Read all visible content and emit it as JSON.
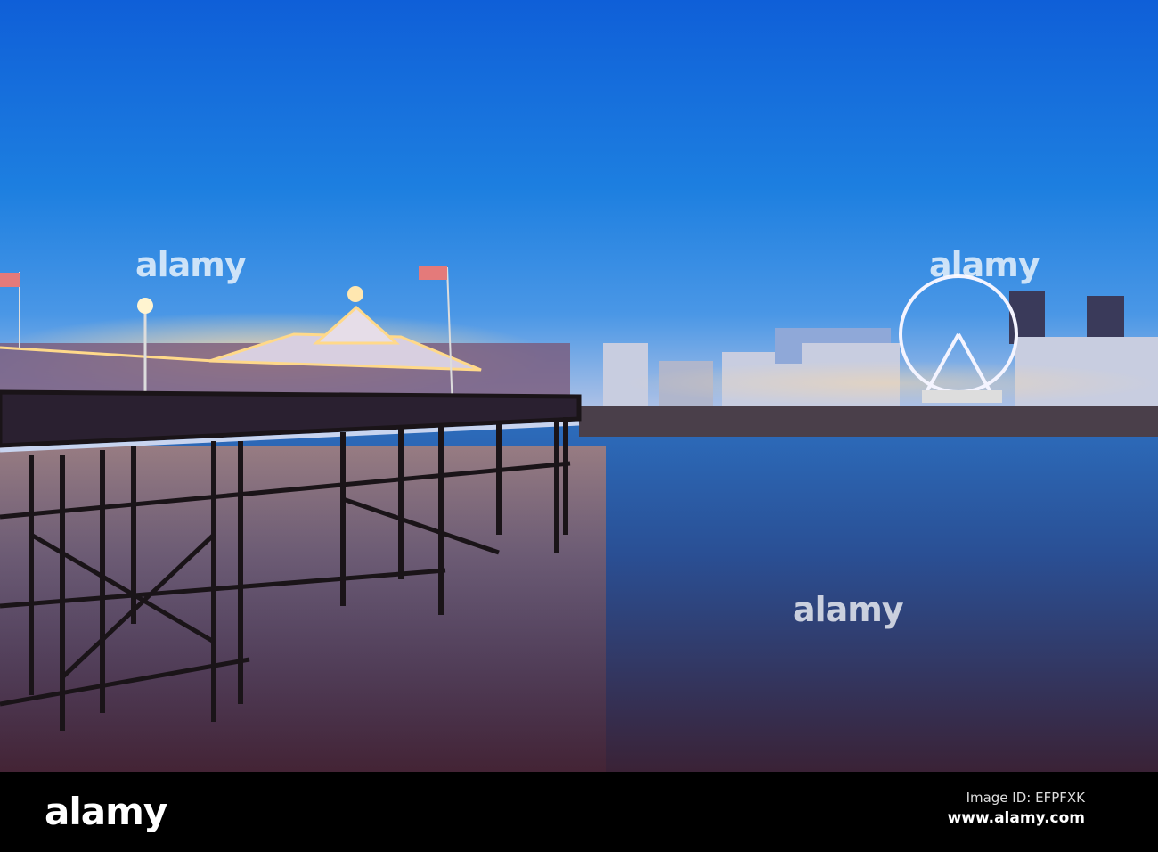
{
  "watermark": {
    "text": "alamy"
  },
  "footer": {
    "logo": "alamy",
    "image_id": "Image ID: EFPFXK",
    "website": "www.alamy.com"
  }
}
